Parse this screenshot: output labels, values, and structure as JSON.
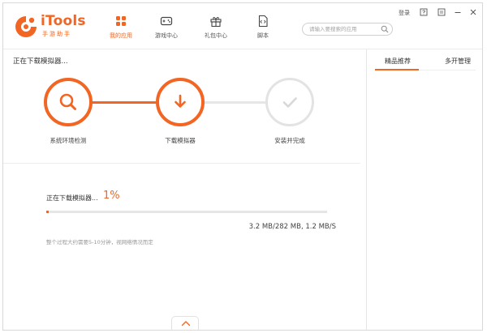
{
  "app": {
    "logo_name": "iTools",
    "logo_sub": "手游助手"
  },
  "nav": {
    "tabs": [
      {
        "label": "我的应用",
        "icon": "apps-grid-icon",
        "active": true
      },
      {
        "label": "游戏中心",
        "icon": "gamepad-icon",
        "active": false
      },
      {
        "label": "礼包中心",
        "icon": "gift-icon",
        "active": false
      },
      {
        "label": "脚本",
        "icon": "script-file-icon",
        "active": false
      }
    ]
  },
  "search": {
    "placeholder": "请输入要搜索的应用"
  },
  "window_controls": {
    "login_label": "登录"
  },
  "download": {
    "status_title": "正在下载模拟器...",
    "steps": [
      {
        "label": "系统环境检测",
        "state": "done",
        "icon": "search-icon"
      },
      {
        "label": "下载模拟器",
        "state": "active",
        "icon": "download-arrow-icon"
      },
      {
        "label": "安装并完成",
        "state": "pending",
        "icon": "checkmark-icon"
      }
    ],
    "progress_label": "正在下载模拟器...",
    "progress_percent_text": "1%",
    "progress_fraction": 0.01,
    "stats": "3.2 MB/282 MB, 1.2 MB/S",
    "note": "整个过程大约需要5-10分钟，视网络情况而定"
  },
  "side": {
    "tabs": [
      {
        "label": "精品推荐",
        "active": true
      },
      {
        "label": "多开管理",
        "active": false
      }
    ]
  },
  "colors": {
    "accent": "#f26522",
    "pending": "#e3e3e3"
  }
}
